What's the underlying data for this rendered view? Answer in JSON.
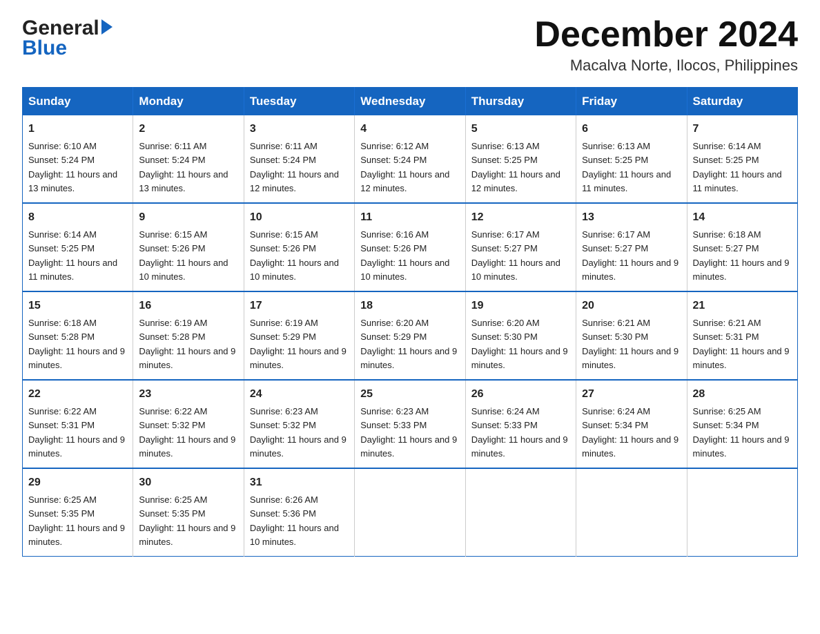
{
  "header": {
    "logo": {
      "line1": "General",
      "line2": "Blue"
    },
    "month": "December 2024",
    "location": "Macalva Norte, Ilocos, Philippines"
  },
  "days_of_week": [
    "Sunday",
    "Monday",
    "Tuesday",
    "Wednesday",
    "Thursday",
    "Friday",
    "Saturday"
  ],
  "weeks": [
    [
      {
        "day": "1",
        "sunrise": "6:10 AM",
        "sunset": "5:24 PM",
        "daylight": "11 hours and 13 minutes."
      },
      {
        "day": "2",
        "sunrise": "6:11 AM",
        "sunset": "5:24 PM",
        "daylight": "11 hours and 13 minutes."
      },
      {
        "day": "3",
        "sunrise": "6:11 AM",
        "sunset": "5:24 PM",
        "daylight": "11 hours and 12 minutes."
      },
      {
        "day": "4",
        "sunrise": "6:12 AM",
        "sunset": "5:24 PM",
        "daylight": "11 hours and 12 minutes."
      },
      {
        "day": "5",
        "sunrise": "6:13 AM",
        "sunset": "5:25 PM",
        "daylight": "11 hours and 12 minutes."
      },
      {
        "day": "6",
        "sunrise": "6:13 AM",
        "sunset": "5:25 PM",
        "daylight": "11 hours and 11 minutes."
      },
      {
        "day": "7",
        "sunrise": "6:14 AM",
        "sunset": "5:25 PM",
        "daylight": "11 hours and 11 minutes."
      }
    ],
    [
      {
        "day": "8",
        "sunrise": "6:14 AM",
        "sunset": "5:25 PM",
        "daylight": "11 hours and 11 minutes."
      },
      {
        "day": "9",
        "sunrise": "6:15 AM",
        "sunset": "5:26 PM",
        "daylight": "11 hours and 10 minutes."
      },
      {
        "day": "10",
        "sunrise": "6:15 AM",
        "sunset": "5:26 PM",
        "daylight": "11 hours and 10 minutes."
      },
      {
        "day": "11",
        "sunrise": "6:16 AM",
        "sunset": "5:26 PM",
        "daylight": "11 hours and 10 minutes."
      },
      {
        "day": "12",
        "sunrise": "6:17 AM",
        "sunset": "5:27 PM",
        "daylight": "11 hours and 10 minutes."
      },
      {
        "day": "13",
        "sunrise": "6:17 AM",
        "sunset": "5:27 PM",
        "daylight": "11 hours and 9 minutes."
      },
      {
        "day": "14",
        "sunrise": "6:18 AM",
        "sunset": "5:27 PM",
        "daylight": "11 hours and 9 minutes."
      }
    ],
    [
      {
        "day": "15",
        "sunrise": "6:18 AM",
        "sunset": "5:28 PM",
        "daylight": "11 hours and 9 minutes."
      },
      {
        "day": "16",
        "sunrise": "6:19 AM",
        "sunset": "5:28 PM",
        "daylight": "11 hours and 9 minutes."
      },
      {
        "day": "17",
        "sunrise": "6:19 AM",
        "sunset": "5:29 PM",
        "daylight": "11 hours and 9 minutes."
      },
      {
        "day": "18",
        "sunrise": "6:20 AM",
        "sunset": "5:29 PM",
        "daylight": "11 hours and 9 minutes."
      },
      {
        "day": "19",
        "sunrise": "6:20 AM",
        "sunset": "5:30 PM",
        "daylight": "11 hours and 9 minutes."
      },
      {
        "day": "20",
        "sunrise": "6:21 AM",
        "sunset": "5:30 PM",
        "daylight": "11 hours and 9 minutes."
      },
      {
        "day": "21",
        "sunrise": "6:21 AM",
        "sunset": "5:31 PM",
        "daylight": "11 hours and 9 minutes."
      }
    ],
    [
      {
        "day": "22",
        "sunrise": "6:22 AM",
        "sunset": "5:31 PM",
        "daylight": "11 hours and 9 minutes."
      },
      {
        "day": "23",
        "sunrise": "6:22 AM",
        "sunset": "5:32 PM",
        "daylight": "11 hours and 9 minutes."
      },
      {
        "day": "24",
        "sunrise": "6:23 AM",
        "sunset": "5:32 PM",
        "daylight": "11 hours and 9 minutes."
      },
      {
        "day": "25",
        "sunrise": "6:23 AM",
        "sunset": "5:33 PM",
        "daylight": "11 hours and 9 minutes."
      },
      {
        "day": "26",
        "sunrise": "6:24 AM",
        "sunset": "5:33 PM",
        "daylight": "11 hours and 9 minutes."
      },
      {
        "day": "27",
        "sunrise": "6:24 AM",
        "sunset": "5:34 PM",
        "daylight": "11 hours and 9 minutes."
      },
      {
        "day": "28",
        "sunrise": "6:25 AM",
        "sunset": "5:34 PM",
        "daylight": "11 hours and 9 minutes."
      }
    ],
    [
      {
        "day": "29",
        "sunrise": "6:25 AM",
        "sunset": "5:35 PM",
        "daylight": "11 hours and 9 minutes."
      },
      {
        "day": "30",
        "sunrise": "6:25 AM",
        "sunset": "5:35 PM",
        "daylight": "11 hours and 9 minutes."
      },
      {
        "day": "31",
        "sunrise": "6:26 AM",
        "sunset": "5:36 PM",
        "daylight": "11 hours and 10 minutes."
      },
      null,
      null,
      null,
      null
    ]
  ],
  "labels": {
    "sunrise": "Sunrise:",
    "sunset": "Sunset:",
    "daylight": "Daylight:"
  },
  "colors": {
    "header_bg": "#1565c0",
    "header_text": "#ffffff",
    "border": "#1565c0",
    "logo_blue": "#1565c0"
  }
}
